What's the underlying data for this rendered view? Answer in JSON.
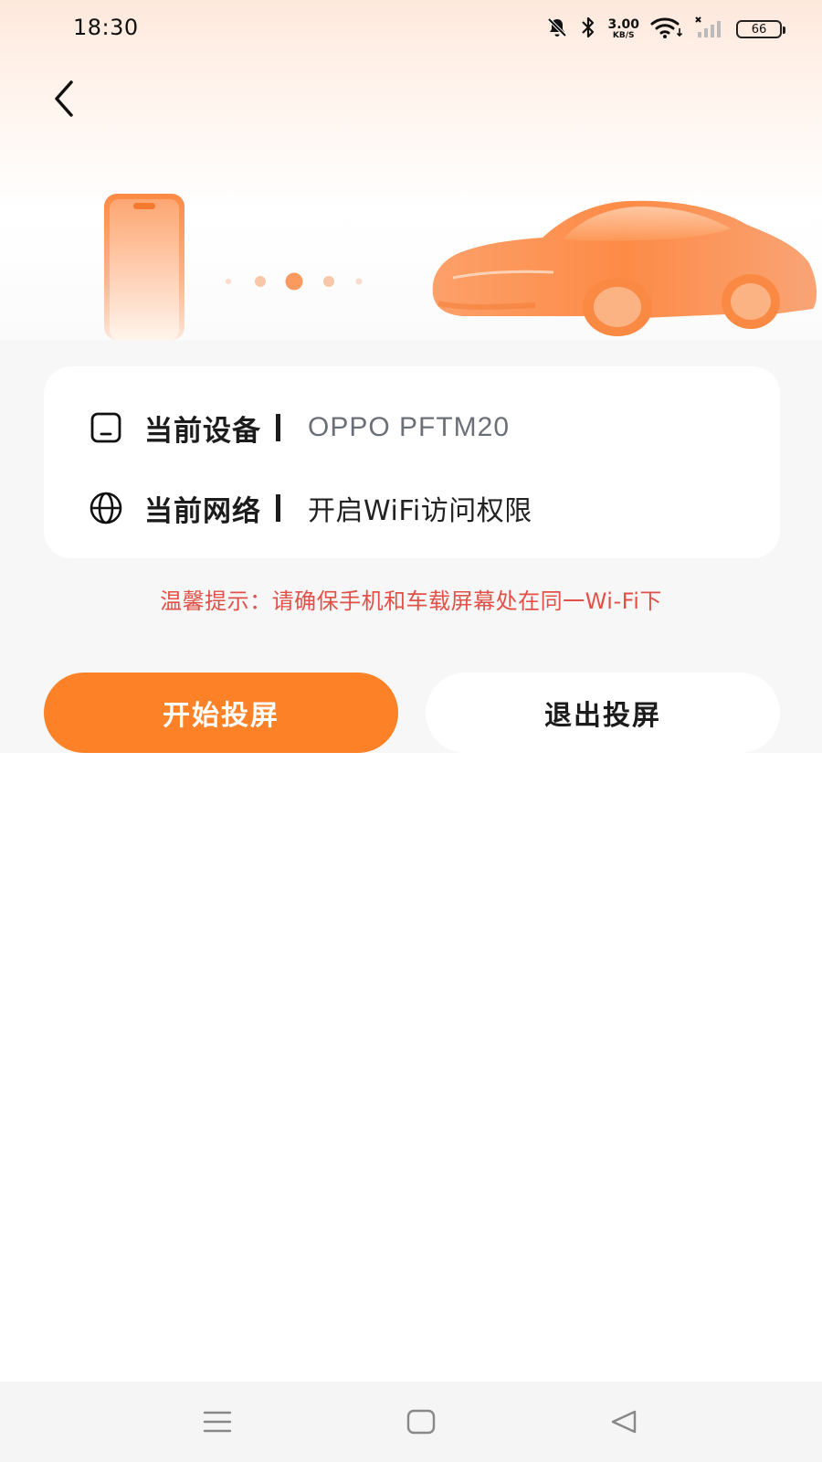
{
  "status_bar": {
    "time": "18:30",
    "net_speed_value": "3.00",
    "net_speed_unit": "KB/S",
    "battery": "66",
    "icons": [
      "mute-bell-icon",
      "bluetooth-icon",
      "wifi-icon",
      "cellular-no-signal-icon",
      "battery-icon"
    ]
  },
  "header": {
    "back_icon": "chevron-left-icon"
  },
  "hero": {
    "illustration": [
      "phone-illustration",
      "connection-dots",
      "car-illustration"
    ],
    "accent_color": "#fd8127"
  },
  "info_card": {
    "device": {
      "icon": "tablet-icon",
      "label": "当前设备",
      "value": "OPPO PFTM20"
    },
    "network": {
      "icon": "globe-icon",
      "label": "当前网络",
      "value": "开启WiFi访问权限"
    }
  },
  "tip": {
    "text": "温馨提示：请确保手机和车载屏幕处在同一Wi-Fi下",
    "color": "#e25148"
  },
  "buttons": {
    "start_label": "开始投屏",
    "exit_label": "退出投屏",
    "start_color": "#fd8127"
  },
  "nav_bar": {
    "icons": [
      "menu-icon",
      "home-icon",
      "back-triangle-icon"
    ]
  }
}
